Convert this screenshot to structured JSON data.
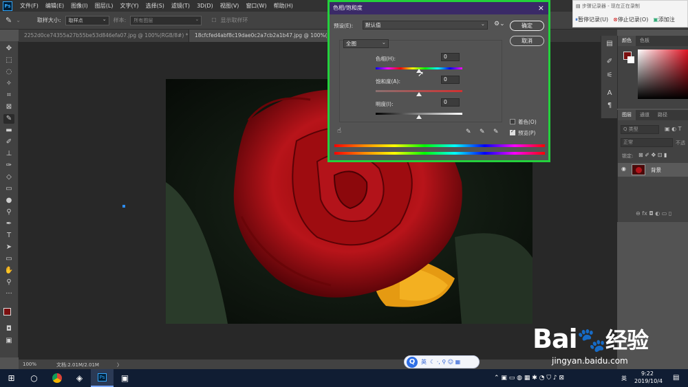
{
  "menubar": {
    "logo": "Ps",
    "items": [
      "文件(F)",
      "编辑(E)",
      "图像(I)",
      "图层(L)",
      "文字(Y)",
      "选择(S)",
      "滤镜(T)",
      "3D(D)",
      "视图(V)",
      "窗口(W)",
      "帮助(H)"
    ]
  },
  "options": {
    "sample_size_label": "取样大小:",
    "sample_size_value": "取样点",
    "sample_label": "样本:",
    "sample_value": "所有图层",
    "show_ring_label": "显示取样环"
  },
  "tabs": [
    {
      "label": "2252d0ce74355a27b55be53d846efa07.jpg @ 100%(RGB/8#) *",
      "close": "×"
    },
    {
      "label": "18cfcfed4abf8c19dae0c2a7cb2a1b47.jpg @ 100%(RGB/8",
      "close": ""
    }
  ],
  "status": {
    "zoom": "100%",
    "doc": "文档:2.01M/2.01M",
    "arrow": "〉"
  },
  "dialog": {
    "title": "色相/饱和度",
    "close": "×",
    "preset_label": "预设(E):",
    "preset_value": "默认值",
    "ok": "确定",
    "cancel": "取消",
    "channel": "全图",
    "hue_label": "色相(H):",
    "hue_value": "0",
    "saturation_label": "饱和度(A):",
    "saturation_value": "0",
    "lightness_label": "明度(I):",
    "lightness_value": "0",
    "colorize_label": "着色(O)",
    "preview_label": "预览(P)",
    "colorize_checked": false,
    "preview_checked": true
  },
  "recorder": {
    "title": "步骤记录器 - 现在正在录制",
    "pause": "暂停记录(U)",
    "stop": "停止记录(O)",
    "add": "添加注"
  },
  "right_panel": {
    "color_tabs": [
      "颜色",
      "色板"
    ],
    "layer_tabs": [
      "图层",
      "通道",
      "路径"
    ],
    "kind_placeholder": "Q 类型",
    "blend_mode": "正常",
    "opacity_label": "不透",
    "lock_label": "锁定:",
    "layer_name": "背景"
  },
  "ime": {
    "q": "Q",
    "lang": "英",
    "icons": "☾ ·, ⚲ ☺ ▦"
  },
  "taskbar": {
    "time": "9:22",
    "date": "2019/10/4",
    "tray_lang": "英",
    "tray_icons": "⌃ ▣ ▭ ◍ ▦ ✱ ◔ ⛉ ♪ ⊠",
    "notify": "▤"
  },
  "watermark": {
    "brand": "Bai",
    "brand2": "经验",
    "url": "jingyan.baidu.com"
  },
  "colors": {
    "dialog_border": "#23d13c",
    "dialog_title_bg": "#3a2a67",
    "taskbar": "#101d33",
    "foreground_swatch": "#7a0f0f"
  }
}
